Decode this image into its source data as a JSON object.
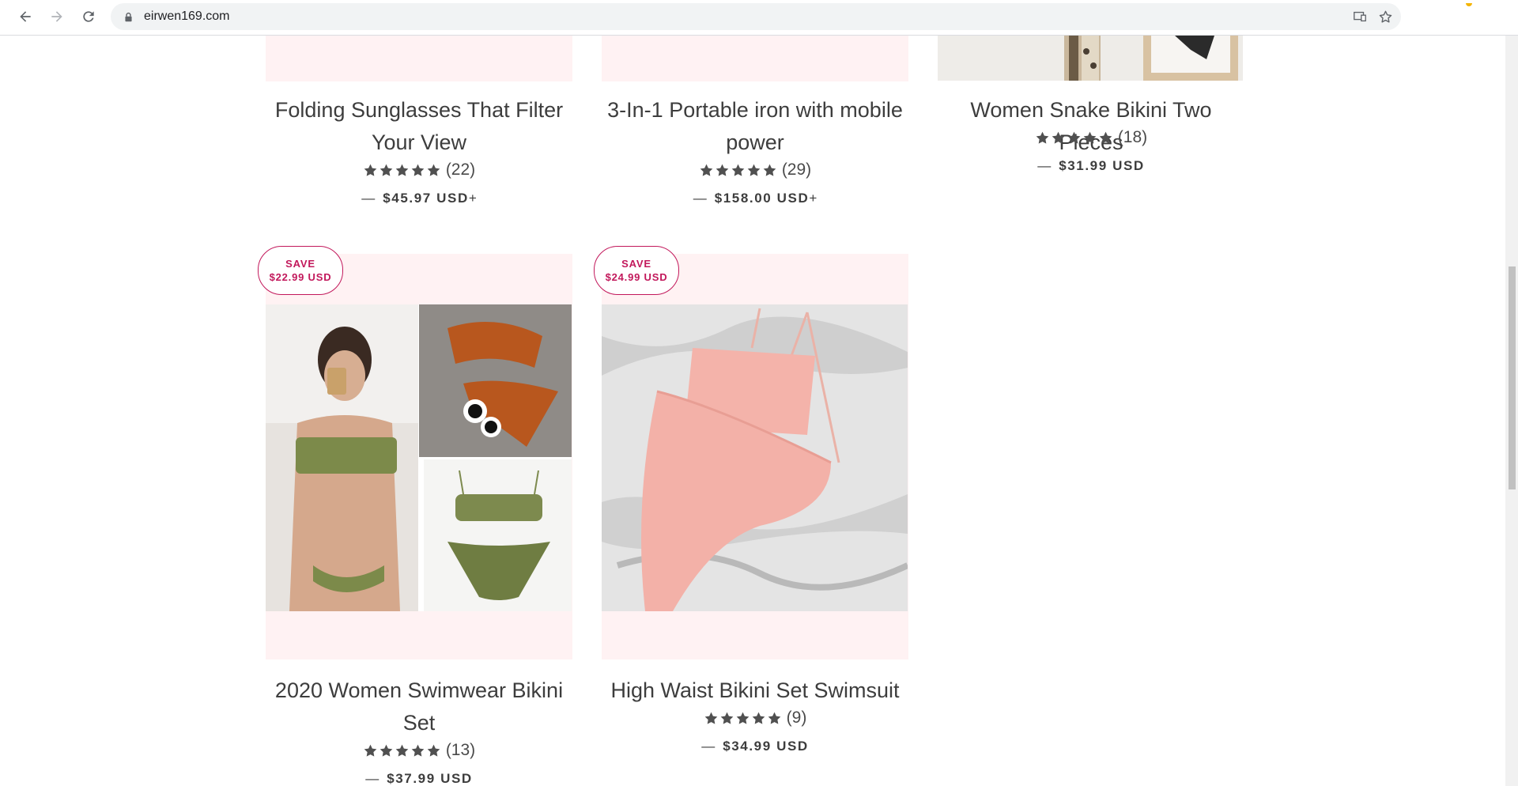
{
  "browser": {
    "url": "eirwen169.com"
  },
  "products": [
    {
      "title": "Folding Sunglasses That Filter Your View",
      "rating_count": "(22)",
      "price": "$45.97 USD",
      "price_suffix": "+",
      "stars": 5
    },
    {
      "title": "3-In-1 Portable iron with mobile power",
      "rating_count": "(29)",
      "price": "$158.00 USD",
      "price_suffix": "+",
      "stars": 5
    },
    {
      "title": "Women Snake Bikini Two Pieces",
      "rating_count": "(18)",
      "price": "$31.99 USD",
      "price_suffix": "",
      "stars": 5
    },
    {
      "title": "2020 Women Swimwear Bikini Set",
      "rating_count": "(13)",
      "price": "$37.99 USD",
      "price_suffix": "",
      "stars": 5,
      "badge_label": "SAVE",
      "badge_amount": "$22.99 USD"
    },
    {
      "title": "High Waist Bikini Set Swimsuit",
      "rating_count": "(9)",
      "price": "$34.99 USD",
      "price_suffix": "",
      "stars": 5,
      "badge_label": "SAVE",
      "badge_amount": "$24.99 USD"
    }
  ],
  "price_dash": "—",
  "colors": {
    "badge": "#c2185b",
    "image_bg": "#fff2f3",
    "text": "#3d3d3d"
  }
}
